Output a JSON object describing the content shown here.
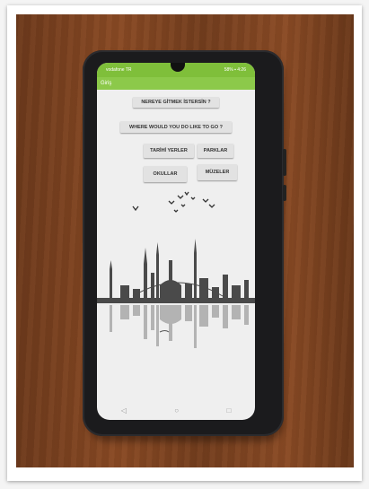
{
  "statusbar": {
    "carrier": "vodafone TR",
    "indicators": "58% ▪ 4:26"
  },
  "appbar": {
    "title": "Giriş"
  },
  "question": {
    "turkish": "NEREYE GİTMEK İSTERSİN ?",
    "english": "WHERE WOULD YOU DO LIKE TO GO ?"
  },
  "options": {
    "historic": "TARİHİ YERLER",
    "parks": "PARKLAR",
    "schools": "OKULLAR",
    "museums": "MÜZELER"
  },
  "nav": {
    "back": "◁",
    "home": "○",
    "recent": "□"
  },
  "colors": {
    "statusbar": "#7fbf3a",
    "appbar": "#8cc94a",
    "wood": "#7a401f"
  }
}
